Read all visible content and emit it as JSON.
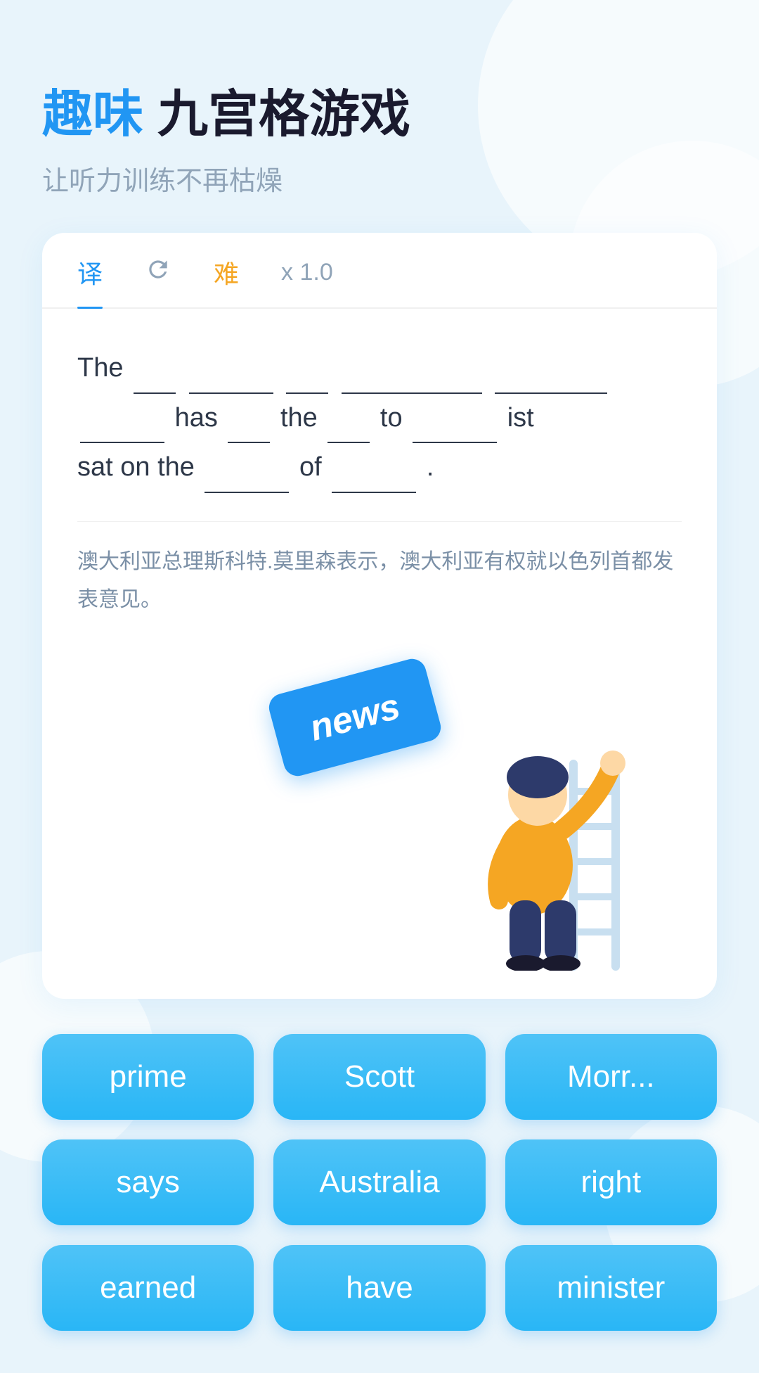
{
  "header": {
    "title_accent": "趣味",
    "title_main": " 九宫格游戏",
    "subtitle": "让听力训练不再枯燥"
  },
  "tabs": [
    {
      "label": "译",
      "active": true
    },
    {
      "label": "↻",
      "active": false
    },
    {
      "label": "难",
      "active": false,
      "difficulty": true
    },
    {
      "label": "x 1.0",
      "active": false
    }
  ],
  "sentence": {
    "line1": "The",
    "blank1": "___",
    "blank2": "______",
    "blank3": "___",
    "blank4": "__________",
    "blank5": "_____",
    "line2_pre": "has",
    "blank6": "___",
    "line2_the": "the",
    "blank7": "___",
    "line2_to": "to",
    "blank8": "_____",
    "line2_ist": "ist",
    "line3_pre": "sat on the",
    "blank9": "____",
    "line3_of": "of",
    "blank10": "_____."
  },
  "translation": "澳大利亚总理斯科特.莫里森表示，澳大利亚有权就以色列首都发表意见。",
  "news_tile": "news",
  "word_buttons": [
    {
      "id": 1,
      "label": "prime"
    },
    {
      "id": 2,
      "label": "Scott"
    },
    {
      "id": 3,
      "label": "Morr..."
    },
    {
      "id": 4,
      "label": "says"
    },
    {
      "id": 5,
      "label": "Australia"
    },
    {
      "id": 6,
      "label": "right"
    },
    {
      "id": 7,
      "label": "earned"
    },
    {
      "id": 8,
      "label": "have"
    },
    {
      "id": 9,
      "label": "minister"
    }
  ],
  "colors": {
    "accent_blue": "#2196F3",
    "text_dark": "#1a1a2e",
    "text_gray": "#90a4b8",
    "btn_blue": "#29b6f6"
  }
}
